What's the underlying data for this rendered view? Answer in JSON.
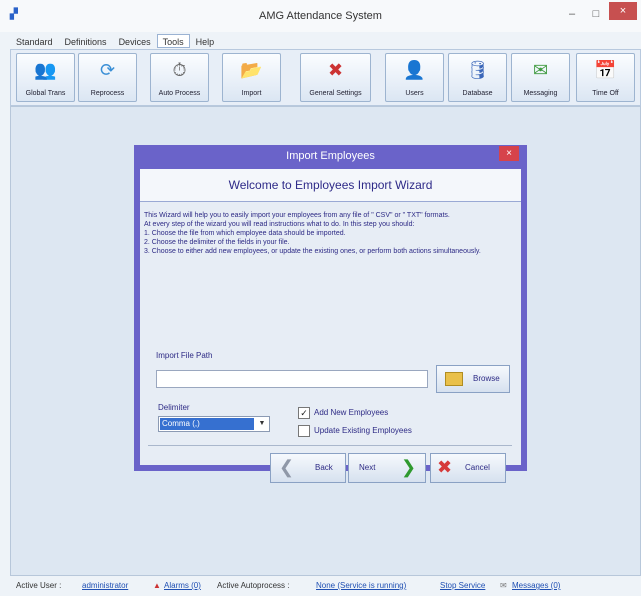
{
  "window": {
    "title": "AMG Attendance System",
    "icon": "app-icon",
    "min": "–",
    "max": "□",
    "close": "×"
  },
  "menu": [
    "Standard",
    "Definitions",
    "Devices",
    "Tools",
    "Help"
  ],
  "toolbar": [
    {
      "label": "Global Trans",
      "icon": "users-group-icon"
    },
    {
      "label": "Reprocess",
      "icon": "reprocess-icon"
    },
    {
      "label": "Auto Process",
      "icon": "stopwatch-icon"
    },
    {
      "label": "Import",
      "icon": "import-icon"
    },
    {
      "label": "General Settings",
      "icon": "tools-icon"
    },
    {
      "label": "Users",
      "icon": "user-icon"
    },
    {
      "label": "Database",
      "icon": "database-icon"
    },
    {
      "label": "Messaging",
      "icon": "message-icon"
    },
    {
      "label": "Time Off",
      "icon": "calendar-icon"
    }
  ],
  "dialog": {
    "title": "Import Employees",
    "close": "×",
    "header": "Welcome to Employees Import Wizard",
    "instructions": [
      "This Wizard will help you to easily import your employees from any file of \" CSV\" or \" TXT\" formats.",
      "At every step of the wizard you will read instructions what to do. In this step you should:",
      "1. Choose the file from which employee data should be imported.",
      "2. Choose the delimiter of the fields in your file.",
      "3. Choose to either add new employees, or update the existing ones, or perform both actions simultaneously."
    ],
    "file_path_label": "Import File Path",
    "file_path_value": "",
    "browse_label": "Browse",
    "delimiter_label": "Delimiter",
    "delimiter_value": "Comma (,)",
    "add_new_label": "Add New Employees",
    "add_new_checked": true,
    "update_label": "Update Existing Employees",
    "update_checked": false,
    "back_label": "Back",
    "next_label": "Next",
    "cancel_label": "Cancel"
  },
  "status": {
    "active_user_label": "Active User :",
    "active_user": "administrator",
    "alarms": "Alarms (0)",
    "autoprocess_label": "Active Autoprocess :",
    "autoprocess": "None (Service is running)",
    "stop_service": "Stop Service",
    "messages": "Messages (0)"
  },
  "colors": {
    "dialog_frame": "#6a63c9",
    "dialog_text": "#2d2a85",
    "close_red": "#d6434b"
  }
}
